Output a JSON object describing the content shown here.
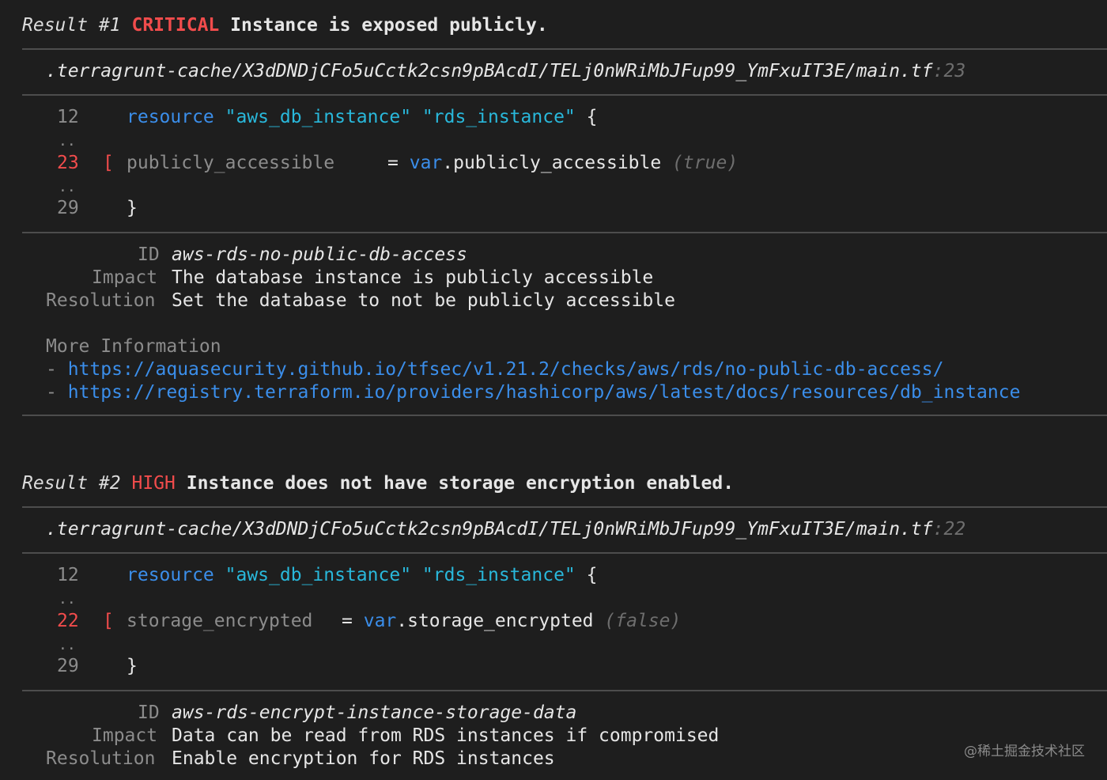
{
  "results": [
    {
      "label": "Result #1",
      "severity": "CRITICAL",
      "title": "Instance is exposed publicly.",
      "path": ".terragrunt-cache/X3dDNDjCFo5uCctk2csn9pBAcdI/TELj0nWRiMbJFup99_YmFxuIT3E/main.tf",
      "line_ref": ":23",
      "code": {
        "l1_num": "12",
        "l1_kw": "resource",
        "l1_s1": "\"aws_db_instance\"",
        "l1_s2": "\"rds_instance\"",
        "l1_brace": "{",
        "dots": "..",
        "l2_num": "23",
        "l2_marker": "[",
        "l2_attr": "publicly_accessible",
        "l2_eq": "=",
        "l2_var": "var",
        "l2_ref": ".publicly_accessible",
        "l2_val": "(true)",
        "l3_num": "29",
        "l3_brace": "}"
      },
      "id_label": "ID",
      "id": "aws-rds-no-public-db-access",
      "impact_label": "Impact",
      "impact": "The database instance is publicly accessible",
      "resolution_label": "Resolution",
      "resolution": "Set the database to not be publicly accessible",
      "more_info_label": "More Information",
      "links": [
        "https://aquasecurity.github.io/tfsec/v1.21.2/checks/aws/rds/no-public-db-access/",
        "https://registry.terraform.io/providers/hashicorp/aws/latest/docs/resources/db_instance"
      ]
    },
    {
      "label": "Result #2",
      "severity": "HIGH",
      "title": "Instance does not have storage encryption enabled.",
      "path": ".terragrunt-cache/X3dDNDjCFo5uCctk2csn9pBAcdI/TELj0nWRiMbJFup99_YmFxuIT3E/main.tf",
      "line_ref": ":22",
      "code": {
        "l1_num": "12",
        "l1_kw": "resource",
        "l1_s1": "\"aws_db_instance\"",
        "l1_s2": "\"rds_instance\"",
        "l1_brace": "{",
        "dots": "..",
        "l2_num": "22",
        "l2_marker": "[",
        "l2_attr": "storage_encrypted",
        "l2_eq": "=",
        "l2_var": "var",
        "l2_ref": ".storage_encrypted",
        "l2_val": "(false)",
        "l3_num": "29",
        "l3_brace": "}"
      },
      "id_label": "ID",
      "id": "aws-rds-encrypt-instance-storage-data",
      "impact_label": "Impact",
      "impact": "Data can be read from RDS instances if compromised",
      "resolution_label": "Resolution",
      "resolution": "Enable encryption for RDS instances"
    }
  ],
  "link_bullet": "-",
  "watermark": "@稀土掘金技术社区",
  "colors": {
    "background": "#1e1e1e",
    "critical": "#f14c4c",
    "keyword": "#3b8eea",
    "link": "#3b8eea",
    "muted": "#8c8c8c"
  }
}
